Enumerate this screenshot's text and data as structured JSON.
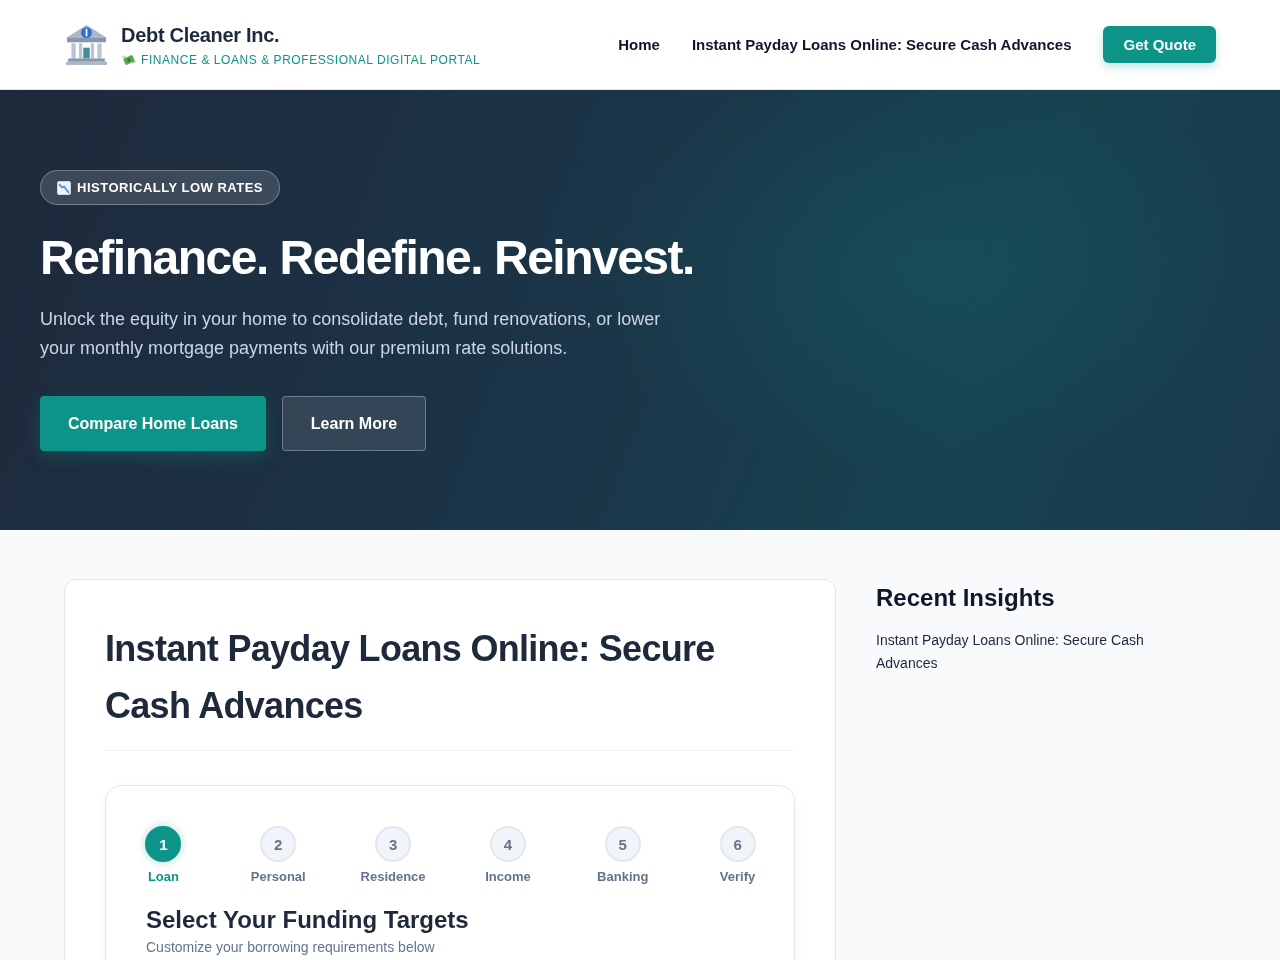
{
  "header": {
    "brand": {
      "name": "Debt Cleaner Inc.",
      "tagline": "FINANCE & LOANS & PROFESSIONAL DIGITAL PORTAL"
    },
    "nav": [
      {
        "label": "Home"
      },
      {
        "label": "Instant Payday Loans Online: Secure Cash Advances"
      }
    ],
    "cta": "Get Quote"
  },
  "hero": {
    "badge": "HISTORICALLY LOW RATES",
    "title": "Refinance. Redefine. Reinvest.",
    "text": "Unlock the equity in your home to consolidate debt, fund renovations, or lower your monthly mortgage payments with our premium rate solutions.",
    "buttons": [
      {
        "label": "Compare Home Loans",
        "kind": "primary"
      },
      {
        "label": "Learn More",
        "kind": "secondary"
      }
    ]
  },
  "article": {
    "title": "Instant Payday Loans Online: Secure Cash Advances",
    "wizard": {
      "steps": [
        {
          "number": "1",
          "label": "Loan",
          "selected": true
        },
        {
          "number": "2",
          "label": "Personal",
          "selected": false
        },
        {
          "number": "3",
          "label": "Residence",
          "selected": false
        },
        {
          "number": "4",
          "label": "Income",
          "selected": false
        },
        {
          "number": "5",
          "label": "Banking",
          "selected": false
        },
        {
          "number": "6",
          "label": "Verify",
          "selected": false
        }
      ],
      "heading": "Select Your Funding Targets",
      "subtext": "Customize your borrowing requirements below"
    }
  },
  "sidebar": {
    "title": "Recent Insights",
    "links": [
      "Instant Payday Loans Online: Secure Cash Advances"
    ]
  }
}
